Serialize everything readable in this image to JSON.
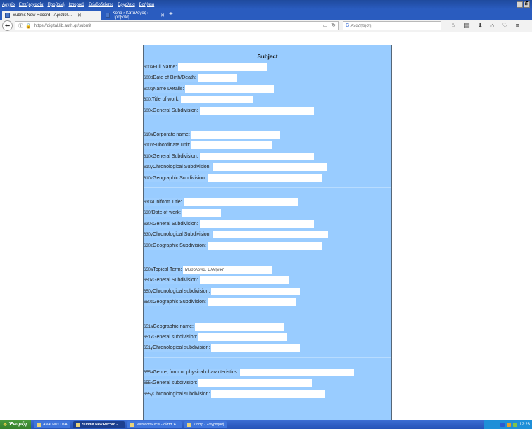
{
  "menubar": {
    "items": [
      "Αρχείο",
      "Επεξεργασία",
      "Προβολή",
      "Ιστορικό",
      "Σελιδοδείκτες",
      "Εργαλεία",
      "Βοήθεια"
    ],
    "window_controls": [
      "_",
      "🗗"
    ]
  },
  "tabs": [
    {
      "label": "Submit New Record - Αριστοτ...",
      "close": "✕"
    },
    {
      "label": "Koha › Κατάλογος › Προβολή ...",
      "close": "✕"
    }
  ],
  "new_tab": "+",
  "navbar": {
    "back": "⬅",
    "url": "https://digital.lib.auth.gr/submit",
    "search_placeholder": "Αναζήτηση"
  },
  "form": {
    "title": "Subject",
    "sections": [
      {
        "fields": [
          {
            "tag": "600a",
            "label": "Full Name:",
            "value": ""
          },
          {
            "tag": "600d",
            "label": "Date of Birth/Death:",
            "value": ""
          },
          {
            "tag": "600q",
            "label": "Name Details:",
            "value": ""
          },
          {
            "tag": "600t",
            "label": "Title of work:",
            "value": ""
          },
          {
            "tag": "600x",
            "label": "General Subdivision:",
            "value": ""
          }
        ]
      },
      {
        "fields": [
          {
            "tag": "610a",
            "label": "Corporate name:",
            "value": ""
          },
          {
            "tag": "610b",
            "label": "Subordinate unit:",
            "value": ""
          },
          {
            "tag": "610x",
            "label": "General Subdivision:",
            "value": ""
          },
          {
            "tag": "610y",
            "label": "Chronological Subdivision:",
            "value": ""
          },
          {
            "tag": "610z",
            "label": "Geographic Subdivision:",
            "value": ""
          }
        ]
      },
      {
        "fields": [
          {
            "tag": "630a",
            "label": "Uniform Title:",
            "value": ""
          },
          {
            "tag": "630f",
            "label": "Date of work:",
            "value": ""
          },
          {
            "tag": "630x",
            "label": "General Subdivision:",
            "value": ""
          },
          {
            "tag": "630y",
            "label": "Chronological Subdivision:",
            "value": ""
          },
          {
            "tag": "630z",
            "label": "Geographic Subdivision:",
            "value": ""
          }
        ]
      },
      {
        "fields": [
          {
            "tag": "650a",
            "label": "Topical Term:",
            "value": "Μυθολογία, Ελληνική"
          },
          {
            "tag": "650x",
            "label": "General Subdivision:",
            "value": ""
          },
          {
            "tag": "650y",
            "label": "Chronological subdivision:",
            "value": ""
          },
          {
            "tag": "650z",
            "label": "Geographic Subdivision:",
            "value": ""
          }
        ]
      },
      {
        "fields": [
          {
            "tag": "651a",
            "label": "Geographic name:",
            "value": ""
          },
          {
            "tag": "651x",
            "label": "General subdivision:",
            "value": ""
          },
          {
            "tag": "651y",
            "label": "Chronological subdivision:",
            "value": ""
          }
        ]
      },
      {
        "fields": [
          {
            "tag": "655a",
            "label": "Genre, form or physical characteristics:",
            "value": ""
          },
          {
            "tag": "655x",
            "label": "General subdivision:",
            "value": ""
          },
          {
            "tag": "655y",
            "label": "Chronological subdivision:",
            "value": ""
          }
        ]
      }
    ]
  },
  "taskbar": {
    "start_label": "Έναρξη",
    "items": [
      {
        "label": "ΑΝΑΓΝΩΣΤΙΚΑ",
        "active": false
      },
      {
        "label": "Submit New Record - ...",
        "active": true
      },
      {
        "label": "Microsoft Excel - Λίστα 'Α...",
        "active": false
      },
      {
        "label": "7.bmp - Ζωγραφική",
        "active": false
      }
    ],
    "clock": "12:23"
  },
  "colors": {
    "panel_bg": "#99ccff",
    "titlebar": "#2a5cbf",
    "taskbar": "#2553b7",
    "start_button": "#35802c"
  }
}
